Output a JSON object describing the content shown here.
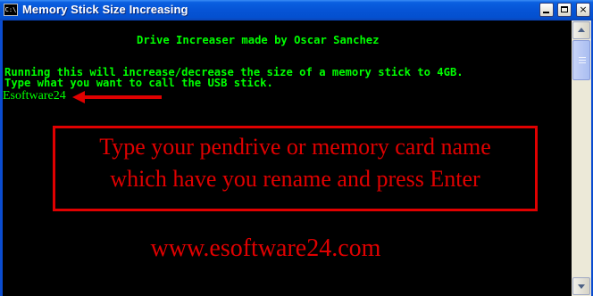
{
  "window": {
    "title": "Memory Stick Size Increasing",
    "app_icon_text": "C:\\",
    "controls": {
      "minimize": "minimize",
      "maximize": "maximize",
      "close": "×"
    }
  },
  "console": {
    "lines": [
      "Drive Increaser made by Oscar Sanchez",
      "Running this will increase/decrease the size of a memory stick to 4GB.",
      "Type what you want to call the USB stick."
    ],
    "input_value": "Esoftware24",
    "text_color": "#00ff00",
    "background": "#000000"
  },
  "annotation": {
    "lines": [
      "Type your pendrive or memory card name",
      "which have you rename and press Enter"
    ],
    "color": "#e00000",
    "arrow_icon": "left-arrow-icon"
  },
  "watermark": "www.esoftware24.com"
}
